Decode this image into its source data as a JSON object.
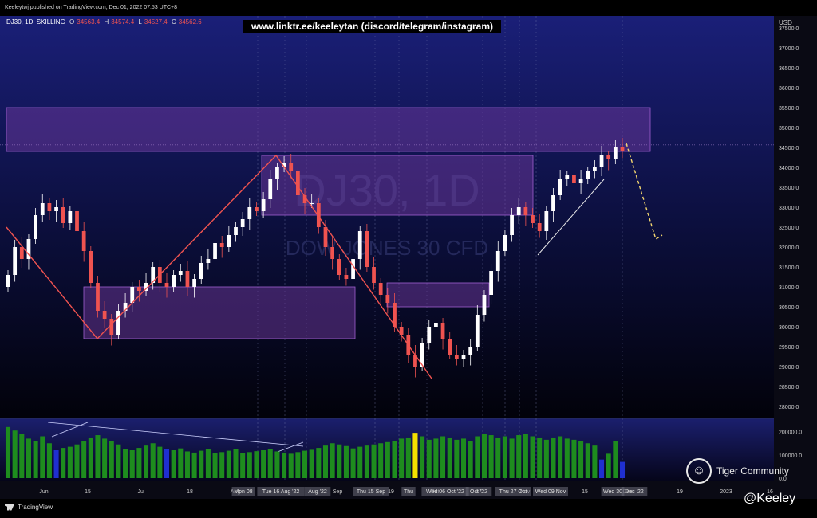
{
  "header": {
    "publish_line": "Keeleytwj published on TradingView.com, Dec 01, 2022 07:53 UTC+8",
    "symbol": "DJ30, 1D, SKILLING",
    "ohlc": [
      {
        "label": "O",
        "value": "34563.4"
      },
      {
        "label": "H",
        "value": "34574.4"
      },
      {
        "label": "L",
        "value": "34527.4"
      },
      {
        "label": "C",
        "value": "34562.6"
      }
    ],
    "link_banner": "www.linktr.ee/keeleytan (discord/telegram/instagram)"
  },
  "watermark": {
    "symbol": "DJ30, 1D",
    "name": "DOW JONES 30 CFD"
  },
  "price_axis": {
    "currency": "USD",
    "ticks": [
      "37500.0",
      "37000.0",
      "36500.0",
      "36000.0",
      "35500.0",
      "35000.0",
      "34500.0",
      "34000.0",
      "33500.0",
      "33000.0",
      "32500.0",
      "32000.0",
      "31500.0",
      "31000.0",
      "30500.0",
      "30000.0",
      "29500.0",
      "29000.0",
      "28500.0",
      "28000.0"
    ]
  },
  "volume_axis": {
    "ticks": [
      "200000.0",
      "100000.0",
      "0.0"
    ]
  },
  "time_axis": {
    "labels": [
      "Jun",
      "15",
      "Jul",
      "18",
      "Aug",
      "Sep",
      "19",
      "Oct",
      "17",
      "Nov",
      "15",
      "Dec",
      "19",
      "2023",
      "16"
    ],
    "crosshair_labels": [
      "Mon 08",
      "Tue 16 Aug '22",
      "Aug '22",
      "Thu 15 Sep",
      "Thu",
      "Wed 06 Oct '22",
      "Oct '22",
      "Thu 27 Oct",
      "Wed 09 Nov",
      "Wed 30",
      "Dec '22"
    ]
  },
  "branding": {
    "tradingview": "TradingView",
    "community": "Tiger Community",
    "handle": "@Keeley"
  },
  "colors": {
    "up": "#ffffff",
    "down": "#ef5350",
    "zone": "#7b3fa8",
    "zigzag": "#ef5350",
    "projection": "#f5d76e",
    "vol_up": "#1e8c1e",
    "vol_down": "#1f2fd0",
    "vol_highlight": "#f5e000"
  },
  "chart_data": {
    "type": "candlestick",
    "symbol": "DJ30",
    "interval": "1D",
    "ylim": [
      27700,
      37800
    ],
    "series": [
      {
        "name": "price",
        "values": [
          31300,
          32000,
          31700,
          32200,
          32800,
          33100,
          32900,
          33000,
          32600,
          32900,
          32400,
          31900,
          31100,
          30400,
          30200,
          29800,
          30400,
          30600,
          31000,
          30900,
          31100,
          31500,
          31100,
          31000,
          31300,
          31400,
          31000,
          31200,
          31600,
          31700,
          32100,
          32000,
          32300,
          32500,
          32700,
          33000,
          32900,
          33200,
          33700,
          34000,
          34100,
          33900,
          33300,
          33100,
          33100,
          32500,
          32000,
          31700,
          31300,
          31200,
          31700,
          32400,
          31500,
          31100,
          30800,
          30600,
          30000,
          29800,
          29300,
          29000,
          29600,
          30000,
          30100,
          29700,
          29300,
          29200,
          29300,
          29500,
          30300,
          30800,
          31400,
          31900,
          32300,
          32800,
          33000,
          32800,
          32600,
          32400,
          32900,
          33300,
          33700,
          33800,
          33600,
          33700,
          33900,
          34000,
          34300,
          34200,
          34500,
          34400
        ]
      }
    ],
    "volume": {
      "ylim": [
        0,
        240000
      ],
      "values": [
        220000,
        205000,
        190000,
        170000,
        160000,
        180000,
        150000,
        120000,
        130000,
        135000,
        145000,
        160000,
        175000,
        185000,
        170000,
        160000,
        145000,
        125000,
        120000,
        130000,
        140000,
        150000,
        135000,
        125000,
        120000,
        128000,
        115000,
        110000,
        118000,
        125000,
        108000,
        112000,
        118000,
        124000,
        108000,
        112000,
        116000,
        120000,
        125000,
        115000,
        110000,
        105000,
        112000,
        118000,
        122000,
        130000,
        140000,
        150000,
        145000,
        138000,
        128000,
        135000,
        140000,
        145000,
        150000,
        155000,
        160000,
        170000,
        175000,
        195000,
        180000,
        165000,
        170000,
        180000,
        175000,
        165000,
        170000,
        160000,
        180000,
        190000,
        185000,
        175000,
        180000,
        170000,
        185000,
        190000,
        180000,
        175000,
        165000,
        175000,
        180000,
        170000,
        165000,
        160000,
        150000,
        140000,
        80000,
        105000,
        160000,
        70000
      ]
    },
    "zones": [
      {
        "name": "resistance-zone",
        "y_range": [
          34400,
          35500
        ]
      },
      {
        "name": "mid-zone",
        "y_range": [
          32800,
          34300
        ]
      },
      {
        "name": "support-zone",
        "y_range": [
          29700,
          31000
        ]
      },
      {
        "name": "small-zone",
        "y_range": [
          30500,
          31100
        ]
      }
    ],
    "current_price": 34562.6
  }
}
